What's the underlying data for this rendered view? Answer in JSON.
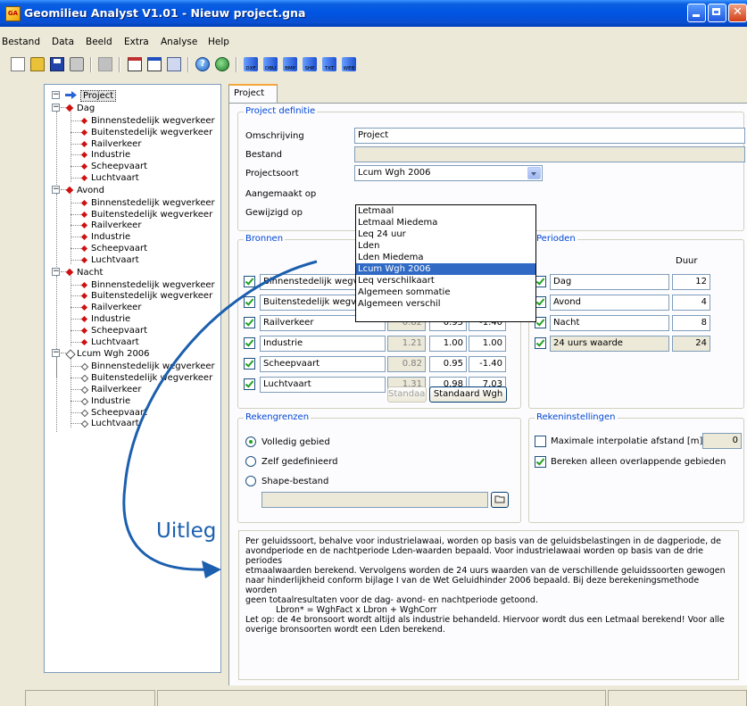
{
  "window": {
    "title": "Geomilieu Analyst V1.01 - Nieuw project.gna",
    "icon_text": "GA"
  },
  "menu": [
    "Bestand",
    "Data",
    "Beeld",
    "Extra",
    "Analyse",
    "Help"
  ],
  "toolbar": {
    "help_glyph": "?",
    "export_labels": [
      "DXF",
      "DBU",
      "BMP",
      "SHP",
      "TXT",
      "WEB"
    ]
  },
  "tree": {
    "root": "Project",
    "groups": [
      {
        "label": "Dag",
        "items": [
          "Binnenstedelijk wegverkeer",
          "Buitenstedelijk wegverkeer",
          "Railverkeer",
          "Industrie",
          "Scheepvaart",
          "Luchtvaart"
        ]
      },
      {
        "label": "Avond",
        "items": [
          "Binnenstedelijk wegverkeer",
          "Buitenstedelijk wegverkeer",
          "Railverkeer",
          "Industrie",
          "Scheepvaart",
          "Luchtvaart"
        ]
      },
      {
        "label": "Nacht",
        "items": [
          "Binnenstedelijk wegverkeer",
          "Buitenstedelijk wegverkeer",
          "Railverkeer",
          "Industrie",
          "Scheepvaart",
          "Luchtvaart"
        ]
      },
      {
        "label": "Lcum Wgh 2006",
        "items": [
          "Binnenstedelijk wegverkeer",
          "Buitenstedelijk wegverkeer",
          "Railverkeer",
          "Industrie",
          "Scheepvaart",
          "Luchtvaart"
        ]
      }
    ]
  },
  "tab": "Project",
  "project_definitie": {
    "title": "Project definitie",
    "omschrijving_label": "Omschrijving",
    "omschrijving_value": "Project",
    "bestand_label": "Bestand",
    "bestand_value": "",
    "projectsoort_label": "Projectsoort",
    "projectsoort_value": "Lcum Wgh 2006",
    "aangemaakt_label": "Aangemaakt op",
    "gewijzigd_label": "Gewijzigd op"
  },
  "dropdown_options": [
    "Letmaal",
    "Letmaal Miedema",
    "Leq 24 uur",
    "Lden",
    "Lden Miedema",
    "Lcum Wgh 2006",
    "Leq verschilkaart",
    "Algemeen sommatie",
    "Algemeen verschil"
  ],
  "dropdown_selected": 5,
  "bronnen": {
    "title": "Bronnen",
    "rows": [
      {
        "name": "Binnenstedelijk wegverkeer",
        "checked": true
      },
      {
        "name": "Buitenstedelijk wegverkeer",
        "checked": true
      },
      {
        "name": "Railverkeer",
        "checked": true,
        "v1": "0.82",
        "v2": "0.95",
        "v3": "-1.40"
      },
      {
        "name": "Industrie",
        "checked": true,
        "v1": "1.21",
        "v2": "1.00",
        "v3": "1.00"
      },
      {
        "name": "Scheepvaart",
        "checked": true,
        "v1": "0.82",
        "v2": "0.95",
        "v3": "-1.40"
      },
      {
        "name": "Luchtvaart",
        "checked": true,
        "v1": "1.31",
        "v2": "0.98",
        "v3": "7.03"
      }
    ],
    "btn_standaard": "Standaard",
    "btn_standaard_wgh": "Standaard Wgh"
  },
  "perioden": {
    "title": "Perioden",
    "duur_header": "Duur",
    "rows": [
      {
        "name": "Dag",
        "duur": "12",
        "checked": true
      },
      {
        "name": "Avond",
        "duur": "4",
        "checked": true
      },
      {
        "name": "Nacht",
        "duur": "8",
        "checked": true
      },
      {
        "name": "24 uurs waarde",
        "duur": "24",
        "checked": true
      }
    ]
  },
  "rekengrenzen": {
    "title": "Rekengrenzen",
    "options": [
      "Volledig gebied",
      "Zelf gedefinieerd",
      "Shape-bestand"
    ],
    "selected": 0,
    "shape_file": ""
  },
  "rekeninstellingen": {
    "title": "Rekeninstellingen",
    "max_interp_label": "Maximale interpolatie afstand [m]",
    "max_interp_value": "0",
    "max_interp_checked": false,
    "overlap_label": "Bereken alleen overlappende gebieden",
    "overlap_checked": true
  },
  "uitleg": {
    "label": "Uitleg",
    "lines": [
      "Per geluidssoort, behalve voor industrielawaai, worden op basis van de geluidsbelastingen in de dagperiode, de",
      "avondperiode en de nachtperiode Lden-waarden bepaald. Voor industrielawaai worden op basis van de drie periodes",
      "etmaalwaarden berekend. Vervolgens worden de 24 uurs waarden van de verschillende geluidssoorten gewogen",
      "naar hinderlijkheid conform bijlage I van de Wet Geluidhinder 2006 bepaald. Bij deze berekeningsmethode worden",
      "geen totaalresultaten voor de dag- avond- en nachtperiode getoond."
    ],
    "formula": "Lbron* = WghFact x Lbron + WghCorr",
    "note": "Let op: de 4e bronsoort wordt altijd als industrie behandeld. Hiervoor wordt dus een Letmaal berekend! Voor alle overige bronsoorten wordt een Lden berekend."
  },
  "colors": {
    "accent": "#0046d5",
    "selection": "#316ac5",
    "arrow": "#1b5fae"
  }
}
